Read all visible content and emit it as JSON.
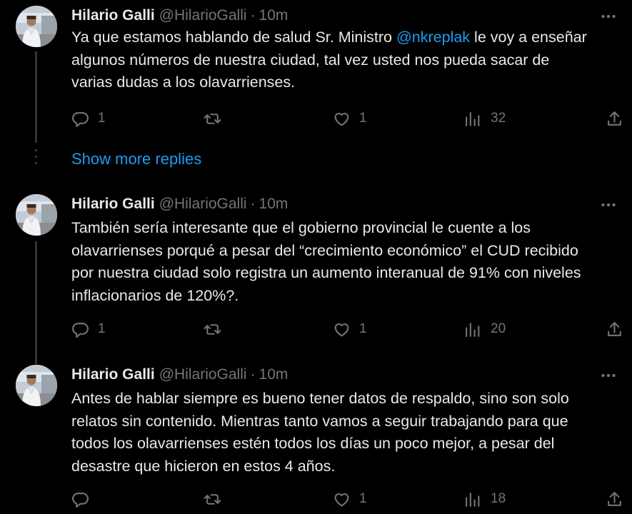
{
  "show_more_label": "Show more replies",
  "colors": {
    "background": "#000000",
    "text": "#e7e9ea",
    "muted": "#71767b",
    "accent": "#1d9bf0"
  },
  "tweets": [
    {
      "name": "Hilario Galli",
      "handle": "@HilarioGalli",
      "separator": "·",
      "time": "10m",
      "lines": [
        {
          "before": "Ya que estamos hablando de salud Sr. Ministro ",
          "mention": "@nkreplak",
          "after": " le voy a enseñar"
        },
        {
          "before": "algunos números de nuestra ciudad, tal vez usted nos pueda sacar de"
        },
        {
          "before": "varias dudas a los olavarrienses."
        }
      ],
      "replies": "1",
      "retweets": "",
      "likes": "1",
      "views": "32"
    },
    {
      "name": "Hilario Galli",
      "handle": "@HilarioGalli",
      "separator": "·",
      "time": "10m",
      "lines": [
        {
          "before": "También sería interesante que el gobierno provincial le cuente a los"
        },
        {
          "before": "olavarrienses porqué a pesar del “crecimiento económico” el CUD recibido"
        },
        {
          "before": "por nuestra ciudad solo registra un aumento interanual de 91% con niveles"
        },
        {
          "before": "inflacionarios de 120%?."
        }
      ],
      "replies": "1",
      "retweets": "",
      "likes": "1",
      "views": "20"
    },
    {
      "name": "Hilario Galli",
      "handle": "@HilarioGalli",
      "separator": "·",
      "time": "10m",
      "lines": [
        {
          "before": "Antes de hablar siempre es bueno tener datos de respaldo, sino son solo"
        },
        {
          "before": "relatos sin contenido. Mientras tanto vamos a seguir trabajando para que"
        },
        {
          "before": "todos los olavarrienses estén todos los días un poco mejor, a pesar del"
        },
        {
          "before": "desastre que hicieron en estos 4 años."
        }
      ],
      "replies": "",
      "retweets": "",
      "likes": "1",
      "views": "18"
    }
  ]
}
